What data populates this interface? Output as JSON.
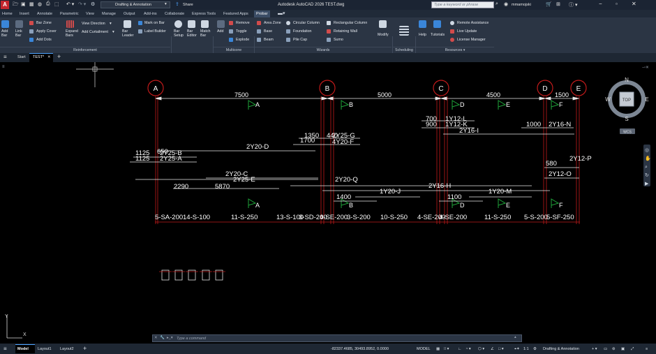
{
  "titlebar": {
    "app_logo": "A",
    "workspace": "Drafting & Annotation",
    "share": "Share",
    "title": "Autodesk AutoCAD 2026    TEST.dwg",
    "search_placeholder": "Type a keyword or phrase",
    "user": "mmamojski"
  },
  "menus": [
    "Home",
    "Insert",
    "Annotate",
    "Parametric",
    "View",
    "Manage",
    "Output",
    "Add-ins",
    "Collaborate",
    "Express Tools",
    "Featured Apps",
    "Probar"
  ],
  "ribbon": {
    "add_bar": "Add\nBar",
    "link_bar": "Link\nBar",
    "bar_zone": "Bar Zone",
    "apply_cover": "Apply Cover",
    "add_dots": "Add Dots",
    "expand_bars": "Expand\nBars",
    "view_direction": "View Direction",
    "add_curtailment": "Add Curtailment",
    "bar_leader": "Bar\nLeader",
    "mark_on_bar": "Mark on Bar",
    "label_builder": "Label Builder",
    "bar_setup": "Bar\nSetup",
    "bar_editor": "Bar\nEditor",
    "match_bar": "Match\nBar",
    "add": "Add",
    "remove": "Remove",
    "toggle": "Toggle",
    "explode": "Explode",
    "area_zone": "Area Zone",
    "base": "Base",
    "beam": "Beam",
    "circular_column": "Circular Column",
    "foundation": "Foundation",
    "pile_cap": "Pile Cap",
    "rectangular_column": "Rectangular Column",
    "retaining_wall": "Retaining Wall",
    "sumo": "Sumo",
    "modify": "Modify",
    "help": "Help",
    "tutorials": "Tutorials",
    "remote_assistance": "Remote Assistance",
    "live_update": "Live Update",
    "license_manager": "License Manager",
    "panels": {
      "reinforcement": "Reinforcement",
      "multicone": "Multicone",
      "wizards": "Wizards",
      "scheduling": "Scheduling",
      "resources": "Resources"
    }
  },
  "doc_tabs": {
    "start": "Start",
    "current": "TEST*"
  },
  "viewcube": {
    "north": "N",
    "south": "S",
    "east": "E",
    "west": "W",
    "top": "TOP",
    "wcs": "WCS"
  },
  "ucs": {
    "x": "X",
    "y": "Y"
  },
  "drawing": {
    "grids": [
      "A",
      "B",
      "C",
      "D",
      "E"
    ],
    "spans": [
      "7500",
      "5000",
      "4500",
      "1500"
    ],
    "section_marks_top": [
      "A",
      "B",
      "D",
      "E",
      "F"
    ],
    "section_marks_bottom": [
      "A",
      "B",
      "D",
      "E",
      "F"
    ],
    "bar_labels": [
      "1Y12-L",
      "1Y12-K",
      "2Y16-I",
      "2Y16-N",
      "2Y25-G",
      "4Y20-F",
      "2Y25-B",
      "2Y25-A",
      "2Y20-D",
      "2Y12-P",
      "2Y12-O",
      "2Y20-C",
      "2Y25-E",
      "2Y20-Q",
      "1Y20-J",
      "2Y16-H",
      "1Y20-M"
    ],
    "dims": [
      "700",
      "900",
      "1000",
      "1350",
      "440",
      "1700",
      "1125",
      "650",
      "1125",
      "580",
      "2290",
      "5870",
      "1400",
      "1100"
    ],
    "zone_labels": [
      "5-SA-200",
      "14-S-100",
      "11-S-250",
      "13-S-100",
      "3-SD-200",
      "4-SE-200",
      "3-S-200",
      "10-S-250",
      "4-SE-200",
      "4-SE-200",
      "11-S-250",
      "5-S-200",
      "5-SF-250"
    ]
  },
  "command": {
    "placeholder": "Type a command"
  },
  "status": {
    "model": "Model",
    "layout1": "Layout1",
    "layout2": "Layout2",
    "coords": "-82337.4685, 30493.8952, 0.0000",
    "space": "MODEL",
    "scale": "1:1",
    "workspace": "Drafting & Annotation"
  }
}
